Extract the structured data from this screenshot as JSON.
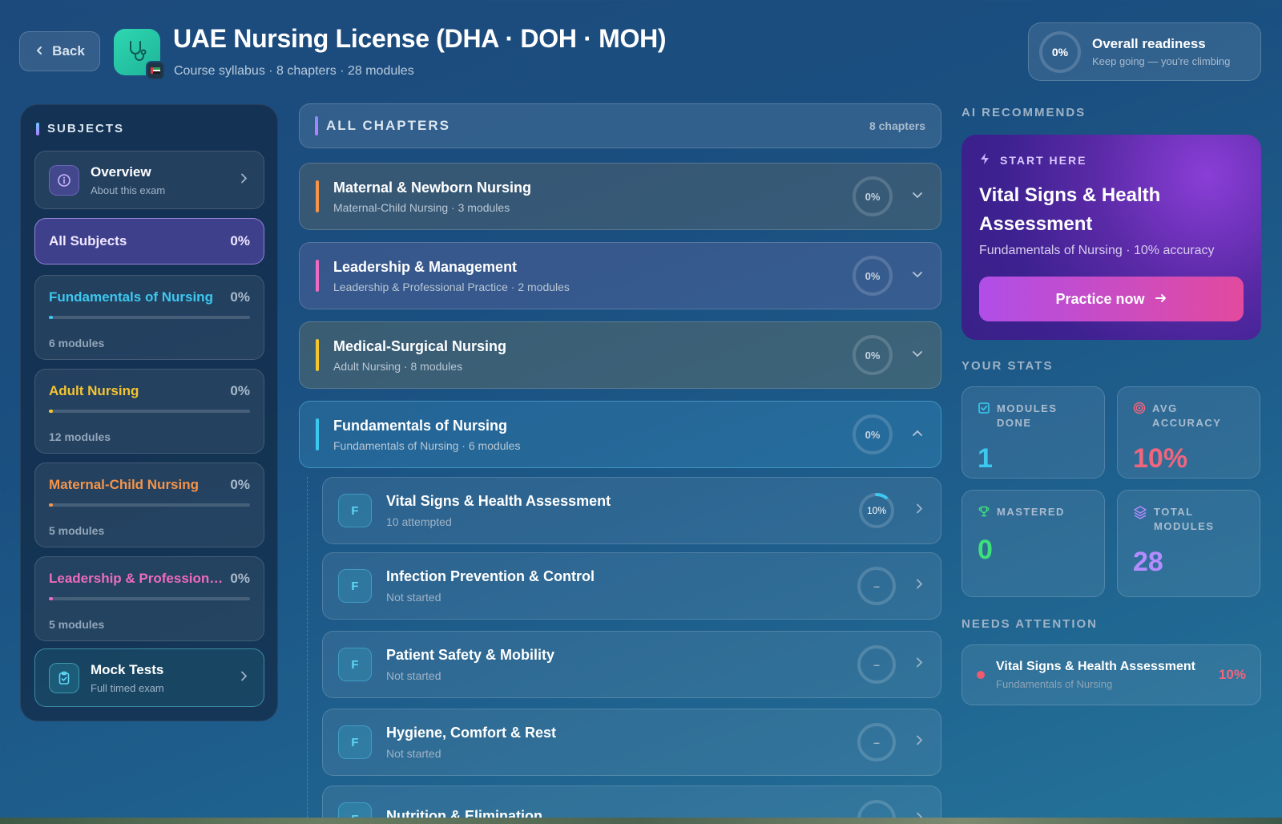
{
  "header": {
    "back_label": "Back",
    "title": "UAE Nursing License (DHA · DOH · MOH)",
    "subtitle": "Course syllabus · 8 chapters · 28 modules",
    "readiness_value": "0%",
    "readiness_title": "Overall readiness",
    "readiness_sub": "Keep going — you're climbing"
  },
  "sidebar": {
    "heading": "SUBJECTS",
    "overview": {
      "title": "Overview",
      "sub": "About this exam",
      "icon": "info-icon"
    },
    "all_subjects": {
      "label": "All Subjects",
      "pct": "0%"
    },
    "subjects": [
      {
        "name": "Fundamentals of Nursing",
        "pct": "0%",
        "modules": "6 modules",
        "color": "#3cc8ef",
        "progress": 0.02
      },
      {
        "name": "Adult Nursing",
        "pct": "0%",
        "modules": "12 modules",
        "color": "#f5c530",
        "progress": 0.02
      },
      {
        "name": "Maternal-Child Nursing",
        "pct": "0%",
        "modules": "5 modules",
        "color": "#f5944a",
        "progress": 0.02
      },
      {
        "name": "Leadership & Professional Practice",
        "pct": "0%",
        "modules": "5 modules",
        "color": "#ee6bbf",
        "progress": 0.02
      }
    ],
    "mock": {
      "title": "Mock Tests",
      "sub": "Full timed exam",
      "icon": "clipboard-icon"
    }
  },
  "chapters_header": {
    "label": "ALL CHAPTERS",
    "count": "8 chapters"
  },
  "chapters": [
    {
      "title": "Maternal & Newborn Nursing",
      "sub": "Maternal-Child Nursing · 3 modules",
      "pct": "0%",
      "color": "#f5944a",
      "bg": "rgba(110,110,100,0.35)",
      "expanded": false
    },
    {
      "title": "Leadership & Management",
      "sub": "Leadership & Professional Practice · 2 modules",
      "pct": "0%",
      "color": "#ee6bbf",
      "bg": "rgba(120,110,170,0.30)",
      "expanded": false
    },
    {
      "title": "Medical-Surgical Nursing",
      "sub": "Adult Nursing · 8 modules",
      "pct": "0%",
      "color": "#f5c530",
      "bg": "rgba(120,120,95,0.35)",
      "expanded": false
    },
    {
      "title": "Fundamentals of Nursing",
      "sub": "Fundamentals of Nursing · 6 modules",
      "pct": "0%",
      "color": "#3cc8ef",
      "bg": "rgba(60,150,200,0.28)",
      "expanded": true
    }
  ],
  "modules": [
    {
      "letter": "F",
      "title": "Vital Signs & Health Assessment",
      "sub": "10 attempted",
      "pct": "10%",
      "progress": 0.1
    },
    {
      "letter": "F",
      "title": "Infection Prevention & Control",
      "sub": "Not started",
      "pct": "–",
      "progress": 0
    },
    {
      "letter": "F",
      "title": "Patient Safety & Mobility",
      "sub": "Not started",
      "pct": "–",
      "progress": 0
    },
    {
      "letter": "F",
      "title": "Hygiene, Comfort & Rest",
      "sub": "Not started",
      "pct": "–",
      "progress": 0
    },
    {
      "letter": "F",
      "title": "Nutrition & Elimination",
      "sub": "",
      "pct": "",
      "progress": 0
    }
  ],
  "recommend": {
    "heading": "AI RECOMMENDS",
    "tag": "START HERE",
    "title": "Vital Signs & Health Assessment",
    "sub": "Fundamentals of Nursing · 10% accuracy",
    "button": "Practice now"
  },
  "stats": {
    "heading": "YOUR STATS",
    "modules_done": {
      "label": "MODULES DONE",
      "value": "1",
      "color": "#3cc8ef"
    },
    "avg_accuracy": {
      "label": "AVG ACCURACY",
      "value": "10%",
      "color": "#f1667e"
    },
    "mastered": {
      "label": "MASTERED",
      "value": "0",
      "color": "#3ee07a"
    },
    "total_modules": {
      "label": "TOTAL MODULES",
      "value": "28",
      "color": "#b48cff"
    }
  },
  "attention": {
    "heading": "NEEDS ATTENTION",
    "title": "Vital Signs & Health Assessment",
    "sub": "Fundamentals of Nursing",
    "pct": "10%"
  }
}
